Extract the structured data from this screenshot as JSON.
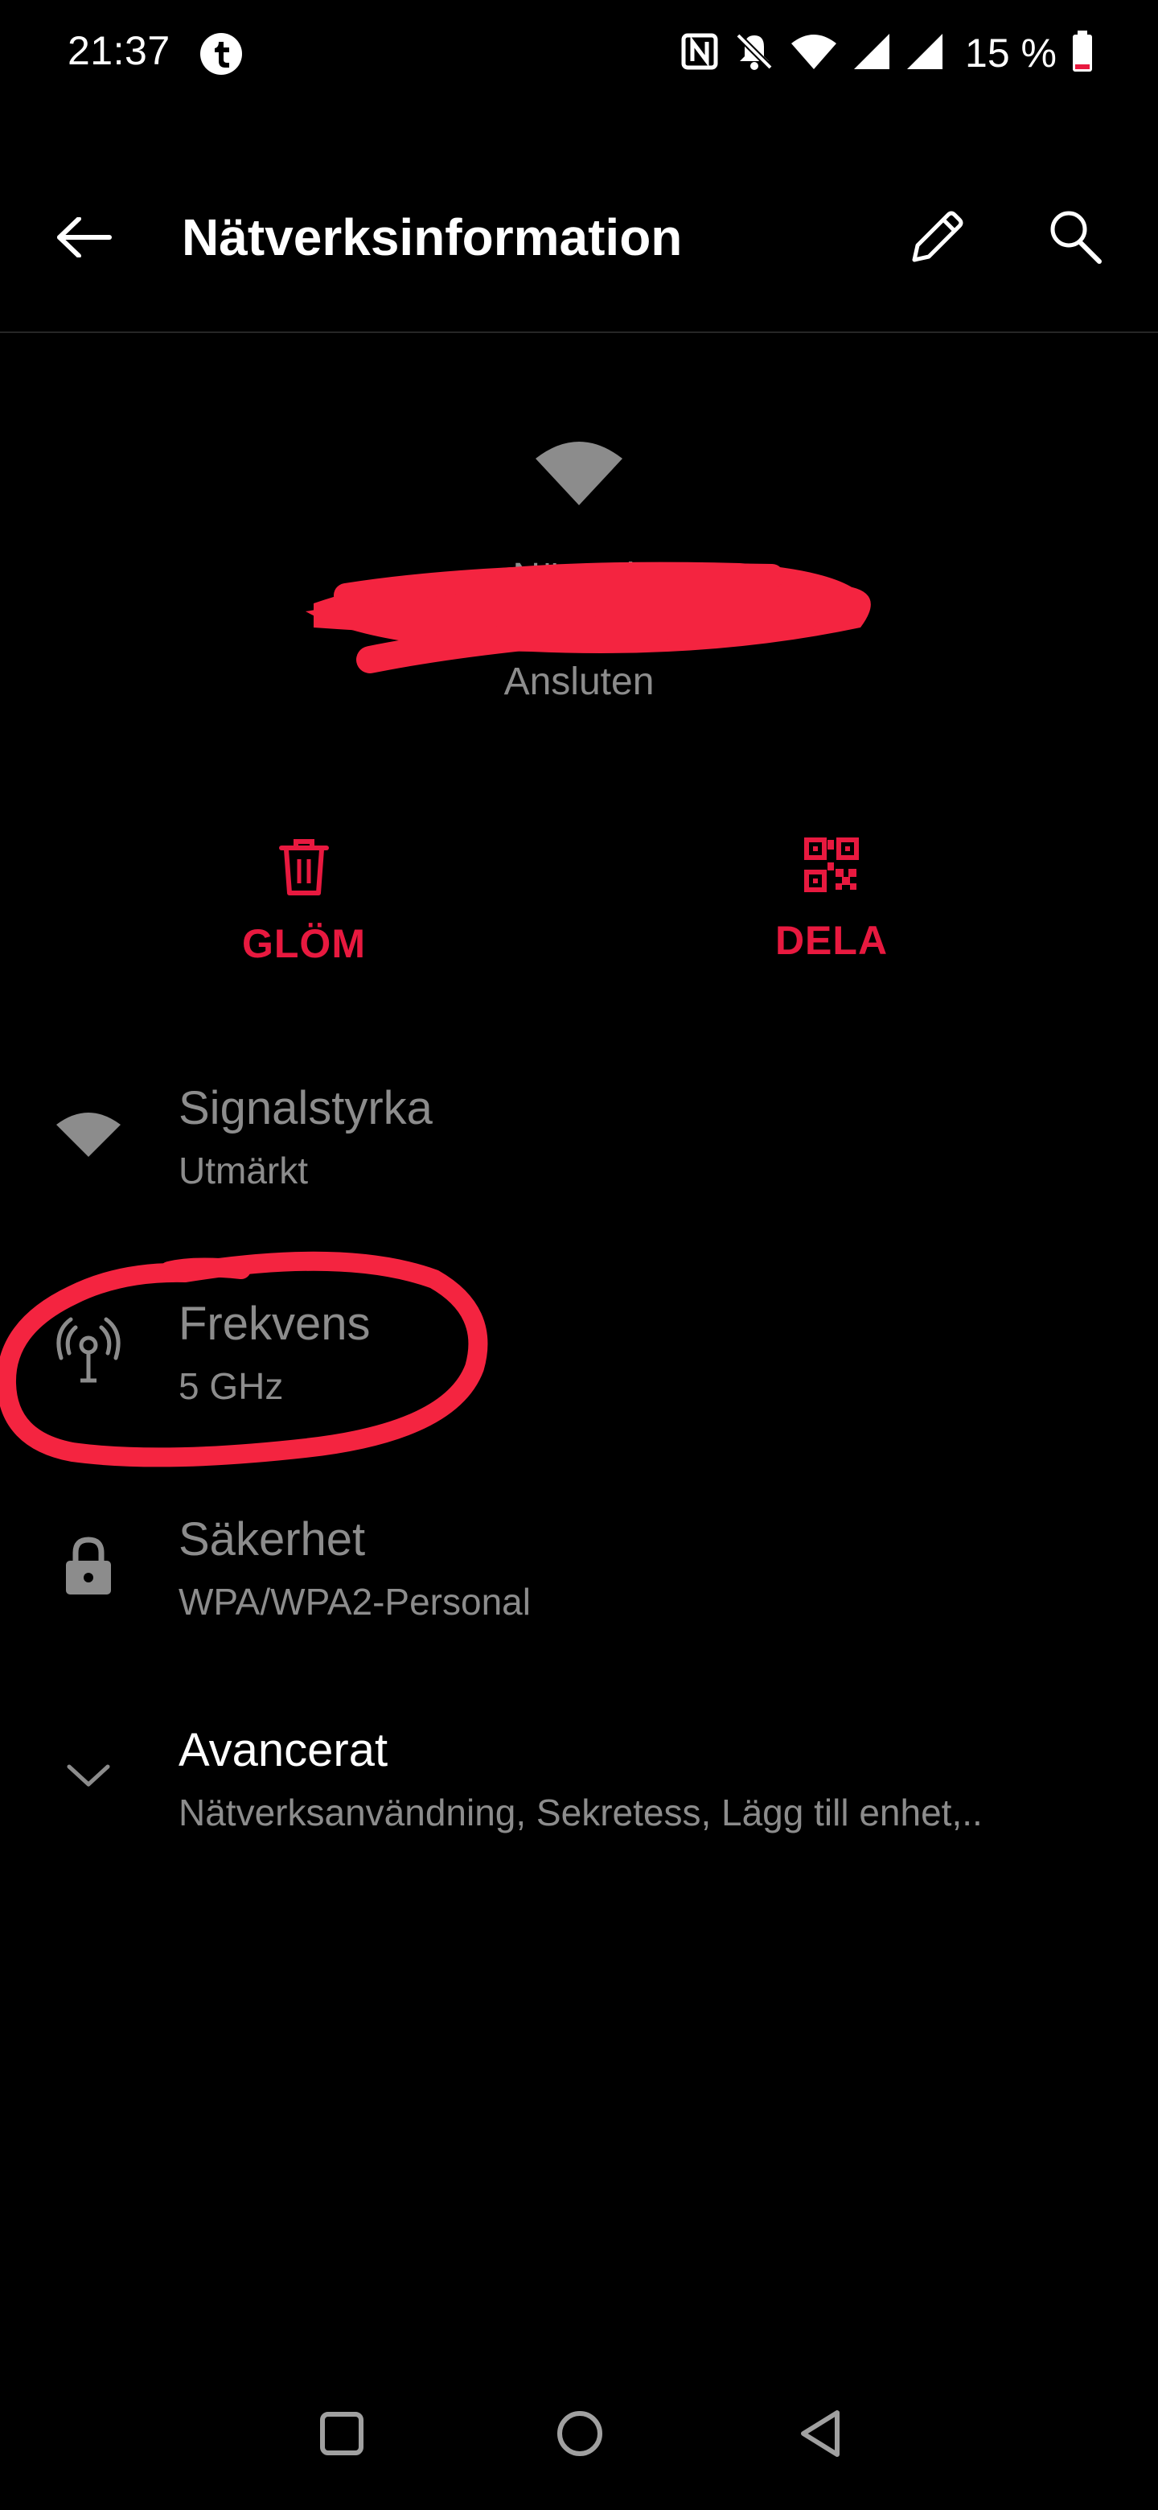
{
  "status_bar": {
    "time": "21:37",
    "battery": "15 %",
    "icons": [
      "t-notification-icon",
      "nfc-icon",
      "bell-muted-icon",
      "wifi-icon",
      "signal-icon",
      "signal-icon",
      "battery-low-icon"
    ],
    "battery_color": "#e8193f"
  },
  "app_bar": {
    "title": "Nätverksinformation",
    "back_icon": "arrow-left-icon",
    "edit_icon": "pencil-icon",
    "search_icon": "search-icon"
  },
  "header": {
    "network_name": "Nätverk",
    "status": "Ansluten"
  },
  "actions": [
    {
      "label": "GLÖM",
      "icon": "trash-icon"
    },
    {
      "label": "DELA",
      "icon": "qr-code-icon"
    }
  ],
  "details": [
    {
      "title": "Signalstyrka",
      "value": "Utmärkt",
      "icon": "wifi-icon"
    },
    {
      "title": "Frekvens",
      "value": "5 GHz",
      "icon": "antenna-icon"
    },
    {
      "title": "Säkerhet",
      "value": "WPA/WPA2-Personal",
      "icon": "lock-icon"
    },
    {
      "title": "Avancerat",
      "value": "Nätverksanvändning, Sekretess, Lägg till enhet,..",
      "icon": "chevron-down-icon"
    }
  ],
  "colors": {
    "accent": "#e8193f",
    "annotation": "#f42440",
    "background": "#000000",
    "muted_text": "#8c8c8c"
  },
  "nav_bar": {
    "icons": [
      "recents-square-icon",
      "home-circle-icon",
      "back-triangle-icon"
    ]
  }
}
